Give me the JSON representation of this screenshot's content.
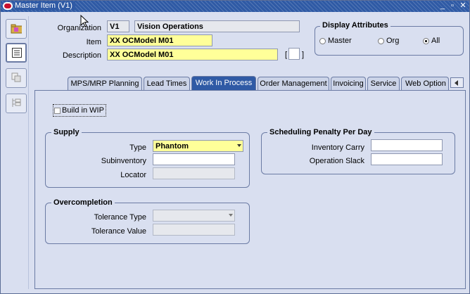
{
  "window": {
    "title": "Master Item (V1)"
  },
  "header": {
    "organization_label": "Organization",
    "organization_code": "V1",
    "organization_name": "Vision Operations",
    "item_label": "Item",
    "item_value": "XX OCModel M01",
    "description_label": "Description",
    "description_value": "XX OCModel M01",
    "flex_left": "[",
    "flex_right": "]"
  },
  "display_attributes": {
    "title": "Display Attributes",
    "options": [
      "Master",
      "Org",
      "All"
    ],
    "selected": "All"
  },
  "tabs": [
    {
      "label": "MPS/MRP Planning",
      "active": false
    },
    {
      "label": "Lead Times",
      "active": false
    },
    {
      "label": "Work In Process",
      "active": true
    },
    {
      "label": "Order Management",
      "active": false
    },
    {
      "label": "Invoicing",
      "active": false
    },
    {
      "label": "Service",
      "active": false
    },
    {
      "label": "Web Option",
      "active": false
    }
  ],
  "wip": {
    "build_in_wip_label": "Build in WIP",
    "build_in_wip_checked": false
  },
  "supply": {
    "title": "Supply",
    "type_label": "Type",
    "type_value": "Phantom",
    "subinventory_label": "Subinventory",
    "subinventory_value": "",
    "locator_label": "Locator",
    "locator_value": ""
  },
  "scheduling_penalty": {
    "title": "Scheduling Penalty Per Day",
    "inventory_carry_label": "Inventory Carry",
    "inventory_carry_value": "",
    "operation_slack_label": "Operation Slack",
    "operation_slack_value": ""
  },
  "overcompletion": {
    "title": "Overcompletion",
    "tolerance_type_label": "Tolerance Type",
    "tolerance_type_value": "",
    "tolerance_value_label": "Tolerance Value",
    "tolerance_value_value": ""
  },
  "colors": {
    "titlebar": "#2f5aa5",
    "background": "#d9dff0",
    "required_field": "#ffff99",
    "active_tab": "#2f5aa5"
  }
}
